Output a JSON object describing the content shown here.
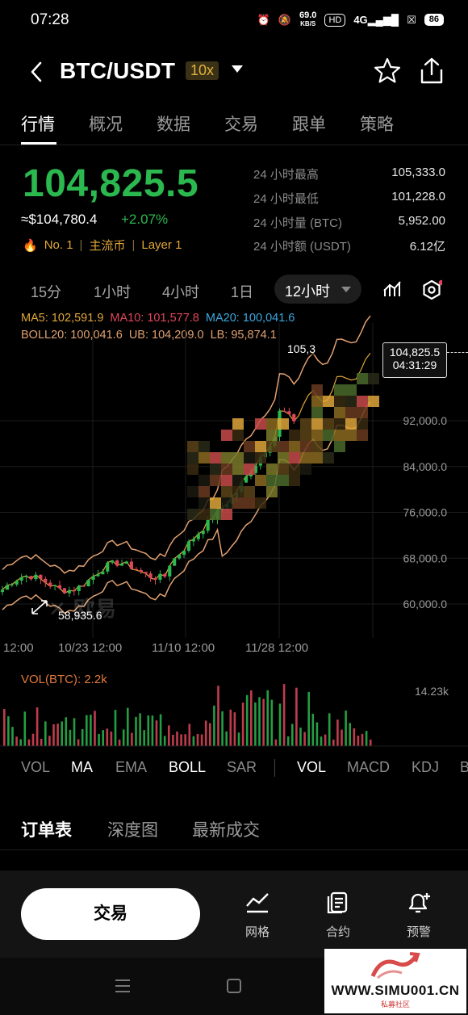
{
  "status_bar": {
    "time": "07:28",
    "net_speed": "69.0",
    "net_unit": "KB/S",
    "hd": "HD",
    "signal": "4G",
    "battery": "86"
  },
  "header": {
    "pair": "BTC/USDT",
    "leverage": "10x"
  },
  "tabs": [
    "行情",
    "概况",
    "数据",
    "交易",
    "跟单",
    "策略"
  ],
  "ticker": {
    "last_price": "104,825.5",
    "fiat_price": "≈$104,780.4",
    "change": "+2.07%",
    "tag_rank": "No. 1",
    "tag_main": "主流币",
    "tag_layer": "Layer 1"
  },
  "stats": [
    {
      "label": "24 小时最高",
      "value": "105,333.0"
    },
    {
      "label": "24 小时最低",
      "value": "101,228.0"
    },
    {
      "label": "24 小时量 (BTC)",
      "value": "5,952.00"
    },
    {
      "label": "24 小时额 (USDT)",
      "value": "6.12亿"
    }
  ],
  "intervals": [
    "15分",
    "1小时",
    "4小时",
    "1日",
    "12小时"
  ],
  "indicators": {
    "ma5": "MA5: 102,591.9",
    "ma10": "MA10: 101,577.8",
    "ma20": "MA20: 100,041.6",
    "boll": "BOLL20: 100,041.6",
    "ub": "UB: 104,209.0",
    "lb": "LB: 95,874.1"
  },
  "price_marker": {
    "price": "104,825.5",
    "countdown": "04:31:29",
    "high_label": "105,3",
    "low_label": "58,935.6"
  },
  "chart_data": {
    "type": "candlestick",
    "ylim": [
      56000,
      108000
    ],
    "y_ticks": [
      "92,000.0",
      "84,000.0",
      "76,000.0",
      "68,000.0",
      "60,000.0"
    ],
    "x_ticks": [
      "12:00",
      "10/23 12:00",
      "11/10 12:00",
      "11/28 12:00"
    ],
    "low_marker": 58935.6,
    "last_price": 104825.5,
    "volume_label": "VOL(BTC): 2.2k",
    "volume_max": "14.23k"
  },
  "watermark_logo": "欧易",
  "indicator_bar": [
    "VOL",
    "MA",
    "EMA",
    "BOLL",
    "SAR",
    "VOL",
    "MACD",
    "KDJ",
    "B"
  ],
  "orderbook_tabs": [
    "订单表",
    "深度图",
    "最新成交"
  ],
  "bottom_bar": {
    "trade": "交易",
    "grid": "网格",
    "contract": "合约",
    "alert": "预警"
  },
  "site_watermark": {
    "url": "WWW.SIMU001.CN",
    "sub": "私募社区"
  },
  "colors": {
    "up": "#2bb84f",
    "down": "#e0465a",
    "accent": "#e0a63a"
  }
}
